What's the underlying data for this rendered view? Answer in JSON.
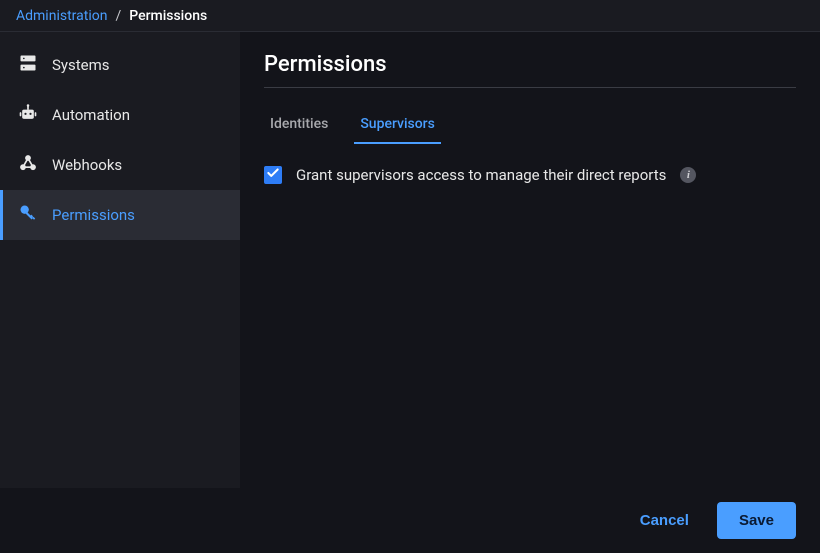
{
  "breadcrumb": {
    "root": "Administration",
    "sep": "/",
    "current": "Permissions"
  },
  "sidebar": {
    "items": [
      {
        "label": "Systems"
      },
      {
        "label": "Automation"
      },
      {
        "label": "Webhooks"
      },
      {
        "label": "Permissions"
      }
    ]
  },
  "main": {
    "title": "Permissions",
    "tabs": {
      "identities": "Identities",
      "supervisors": "Supervisors"
    },
    "option_label": "Grant supervisors access to manage their direct reports"
  },
  "footer": {
    "cancel": "Cancel",
    "save": "Save"
  }
}
